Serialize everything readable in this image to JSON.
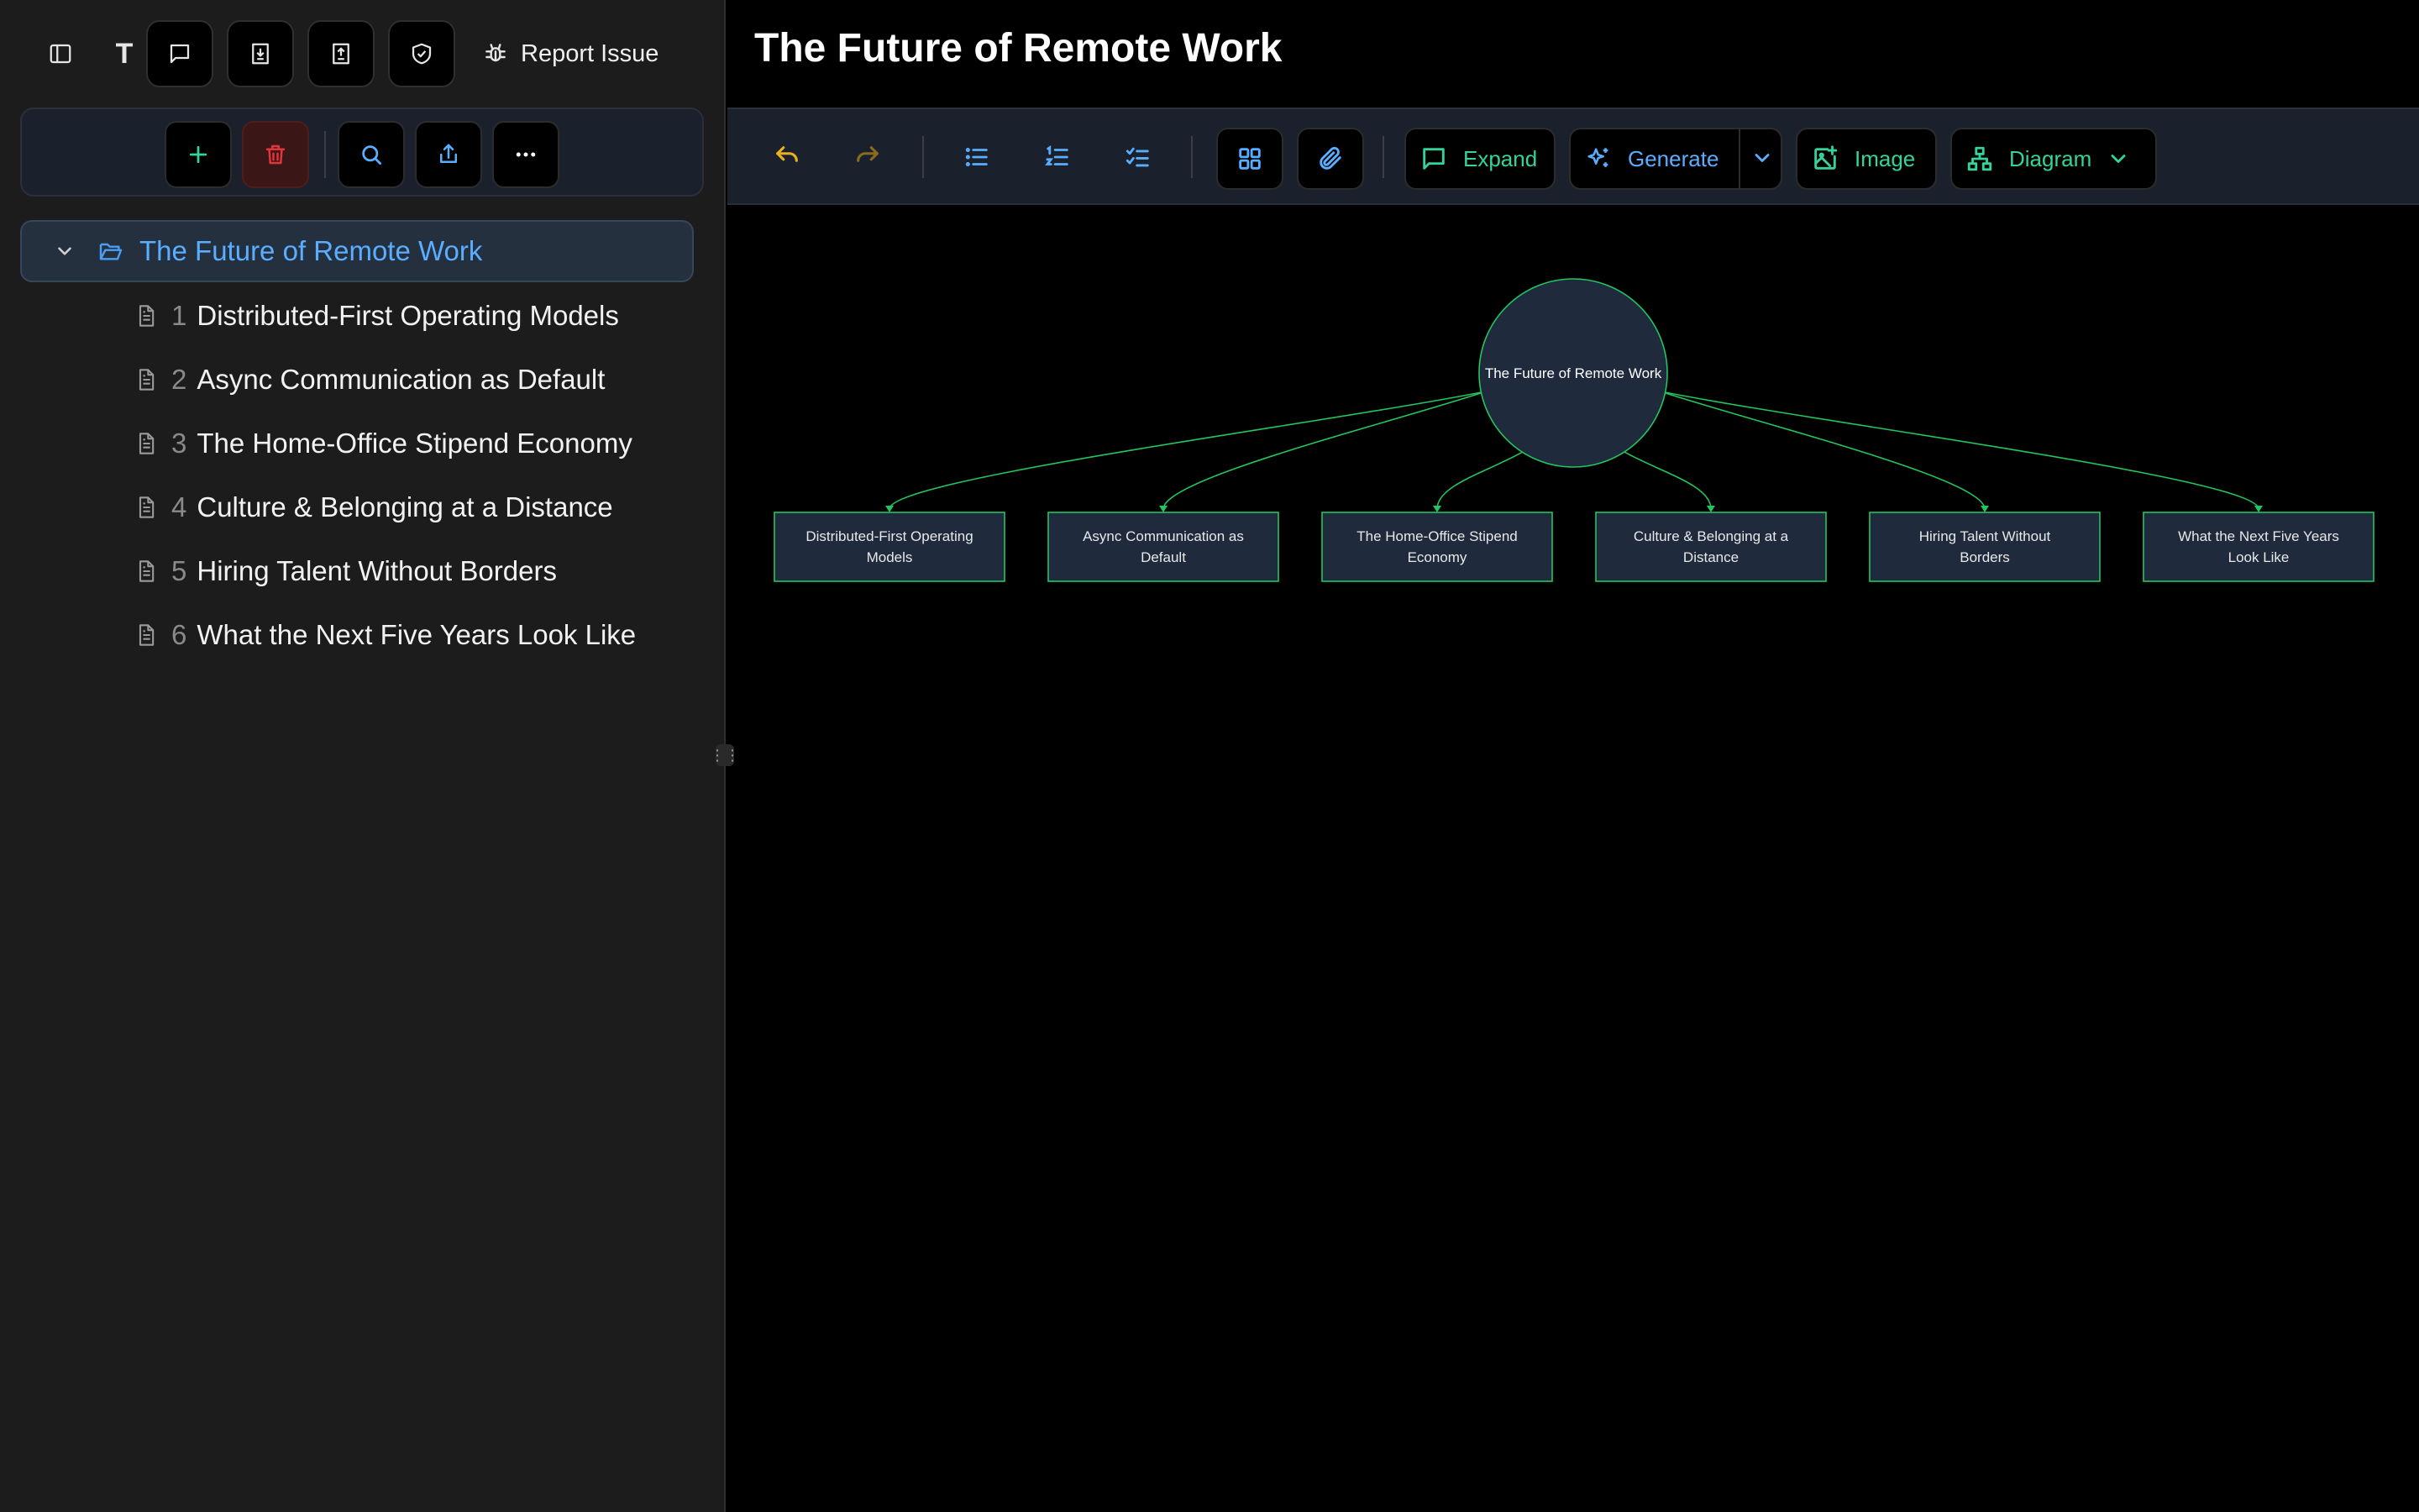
{
  "topbar": {
    "text_tool": "T",
    "report_issue": "Report Issue"
  },
  "tree": {
    "root": "The Future of Remote Work",
    "items": [
      {
        "num": "1",
        "title": "Distributed-First Operating Models"
      },
      {
        "num": "2",
        "title": "Async Communication as Default"
      },
      {
        "num": "3",
        "title": "The Home-Office Stipend Economy"
      },
      {
        "num": "4",
        "title": "Culture & Belonging at a Distance"
      },
      {
        "num": "5",
        "title": "Hiring Talent Without Borders"
      },
      {
        "num": "6",
        "title": "What the Next Five Years Look Like"
      }
    ]
  },
  "document": {
    "title": "The Future of Remote Work"
  },
  "toolbar": {
    "expand": "Expand",
    "generate": "Generate",
    "image": "Image",
    "diagram": "Diagram"
  },
  "diagram": {
    "center": "The Future of Remote Work",
    "nodes": [
      [
        "Distributed-First Operating",
        "Models"
      ],
      [
        "Async Communication as",
        "Default"
      ],
      [
        "The Home-Office Stipend",
        "Economy"
      ],
      [
        "Culture & Belonging at a",
        "Distance"
      ],
      [
        "Hiring Talent Without",
        "Borders"
      ],
      [
        "What the Next Five Years",
        "Look Like"
      ]
    ]
  },
  "colors": {
    "accent_blue": "#5aaeff",
    "accent_green": "#34d399",
    "danger_red": "#e0353a",
    "undo_yellow": "#e8b021",
    "diagram_line": "#22c55e",
    "node_fill": "#1f2a3c"
  },
  "icons": {
    "sidebar_toggle": "sidebar-toggle-icon",
    "comment": "comment-icon",
    "download": "download-icon",
    "upload_doc": "upload-document-icon",
    "shield": "shield-check-icon",
    "bug": "bug-icon",
    "add": "plus-icon",
    "delete": "trash-icon",
    "search": "search-icon",
    "share": "share-icon",
    "more": "more-icon",
    "folder": "folder-open-icon",
    "doc": "document-icon",
    "undo": "undo-icon",
    "redo": "redo-icon",
    "bullet_list": "bullet-list-icon",
    "numbered_list": "numbered-list-icon",
    "checklist": "checklist-icon",
    "grid": "grid-icon",
    "attach": "paperclip-icon",
    "sparkles": "sparkles-icon",
    "image": "image-plus-icon",
    "diagram": "diagram-icon"
  }
}
